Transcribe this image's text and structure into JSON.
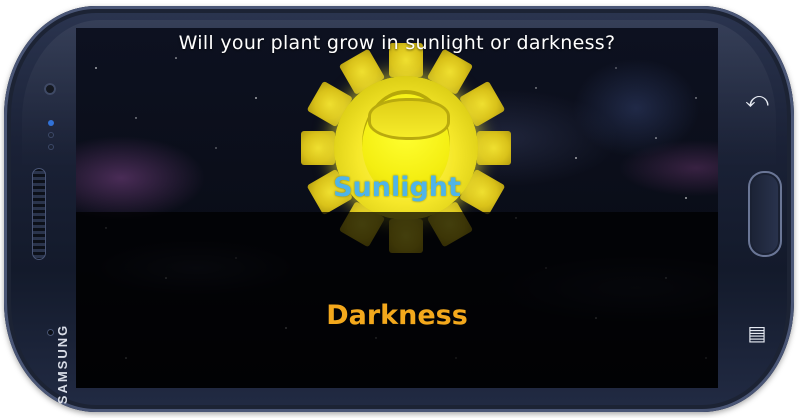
{
  "device": {
    "brand": "SAMSUNG"
  },
  "nav_keys": {
    "back_icon": "back-arrow-icon",
    "menu_icon": "menu-icon"
  },
  "question": "Will your plant grow in sunlight or darkness?",
  "options": {
    "sunlight": {
      "label": "Sunlight",
      "color": "#4fb4e8"
    },
    "darkness": {
      "label": "Darkness",
      "color": "#f3a81c"
    }
  },
  "colors": {
    "sun": "#f6e82a",
    "overlay": "#000000"
  }
}
